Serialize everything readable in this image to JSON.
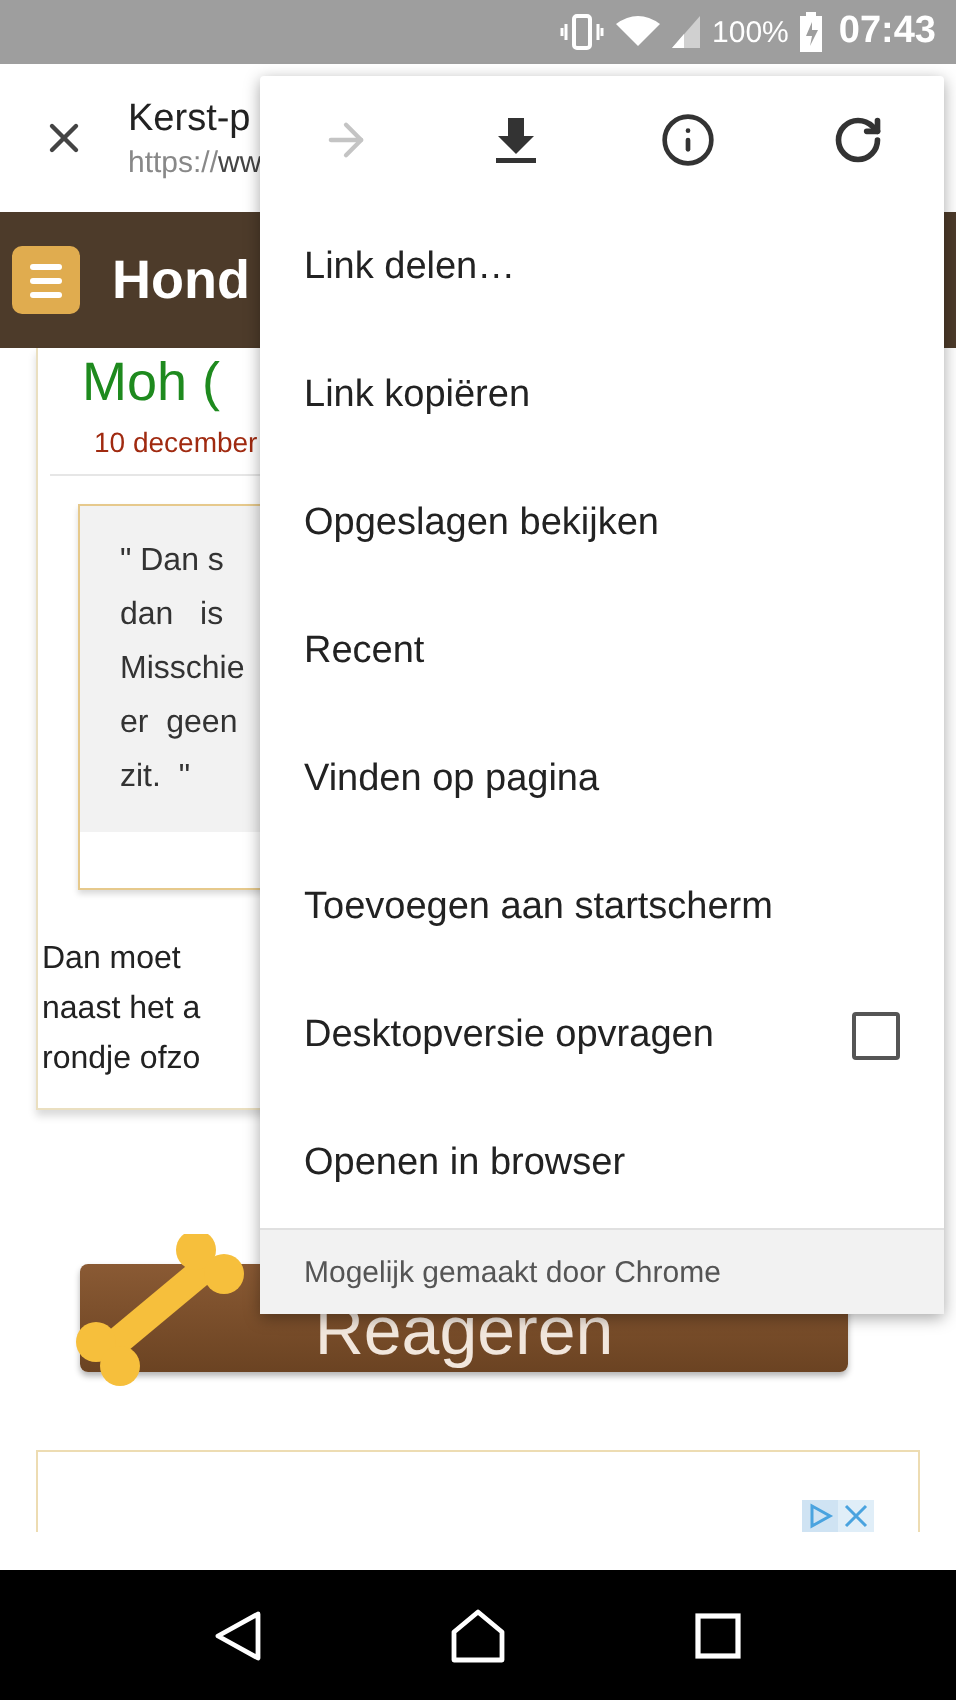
{
  "status_bar": {
    "battery": "100%",
    "time": "07:43"
  },
  "toolbar": {
    "title": "Kerst-p",
    "url_scheme": "https://",
    "url_host": "ww"
  },
  "site_header": {
    "title": "Hond"
  },
  "post": {
    "author": "Moh (",
    "date": "10 december",
    "quote_lines": [
      "\" Dan s",
      "dan   is",
      "Misschie",
      "er  geen",
      "zit.  \""
    ],
    "body_lines": [
      "Dan moet",
      "naast het a",
      "rondje ofzo"
    ],
    "reply_button": "Reageren"
  },
  "menu": {
    "actions": [
      {
        "kind": "forward",
        "disabled": true
      },
      {
        "kind": "download",
        "disabled": false
      },
      {
        "kind": "info",
        "disabled": false
      },
      {
        "kind": "refresh",
        "disabled": false
      }
    ],
    "items": [
      {
        "kind": "plain",
        "label": "Link delen…"
      },
      {
        "kind": "plain",
        "label": "Link kopiëren"
      },
      {
        "kind": "plain",
        "label": "Opgeslagen bekijken"
      },
      {
        "kind": "plain",
        "label": "Recent"
      },
      {
        "kind": "plain",
        "label": "Vinden op pagina"
      },
      {
        "kind": "plain",
        "label": "Toevoegen aan startscherm"
      },
      {
        "kind": "checkbox",
        "label": "Desktopversie opvragen",
        "checked": false
      },
      {
        "kind": "plain",
        "label": "Openen in browser"
      }
    ],
    "footer": "Mogelijk gemaakt door Chrome"
  }
}
